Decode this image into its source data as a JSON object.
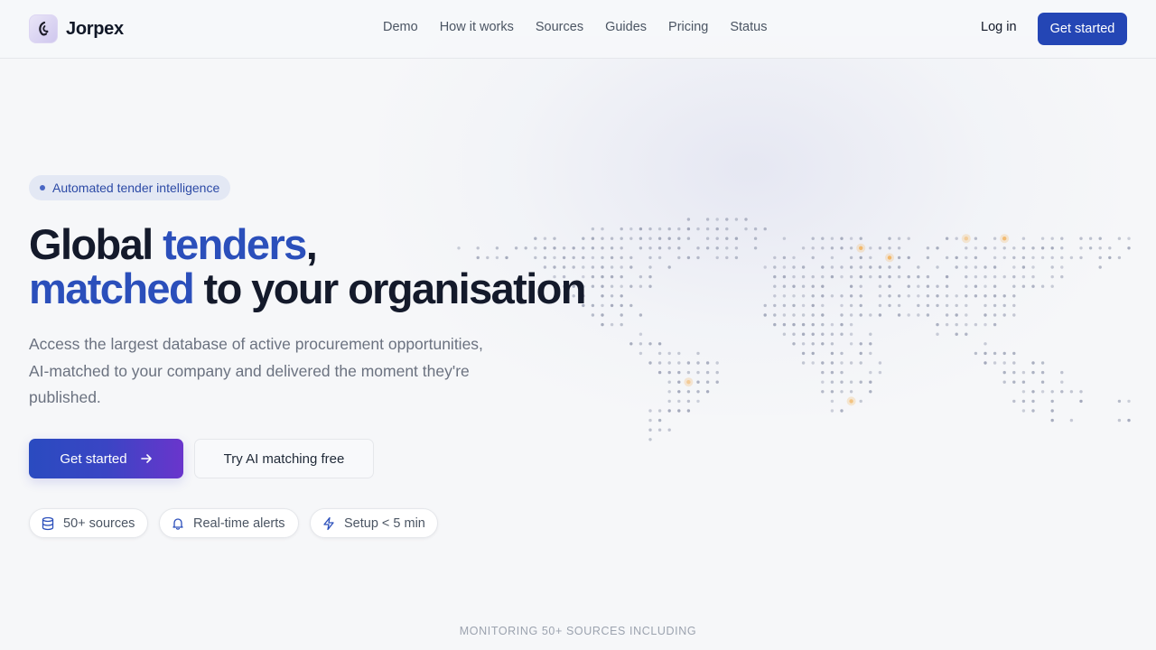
{
  "brand": {
    "name": "Jorpex",
    "logo_icon": "jorpex-logo-icon"
  },
  "nav": {
    "links": [
      "Demo",
      "How it works",
      "Sources",
      "Guides",
      "Pricing",
      "Status"
    ],
    "login_label": "Log in",
    "cta_label": "Get started"
  },
  "hero": {
    "badge": "Automated tender intelligence",
    "headline": {
      "part1": "Global ",
      "accent1": "tenders",
      "part2": ",",
      "accent2": "matched",
      "part3": " to your organisation"
    },
    "subtitle": "Access the largest database of active procurement opportunities, AI-matched to your company and delivered the moment they're published.",
    "primary_cta": "Get started",
    "secondary_cta": "Try AI matching free",
    "features": [
      {
        "icon": "database-icon",
        "label": "50+ sources"
      },
      {
        "icon": "bell-icon",
        "label": "Real-time alerts"
      },
      {
        "icon": "lightning-icon",
        "label": "Setup < 5 min"
      }
    ]
  },
  "sources_strip": {
    "label": "MONITORING 50+ SOURCES INCLUDING"
  },
  "colors": {
    "accent": "#2b4fbb",
    "button": "#2446b5",
    "gradient_end": "#6a35cc",
    "map_dot": "#9aa0b4",
    "map_highlight": "#f2b25c"
  }
}
